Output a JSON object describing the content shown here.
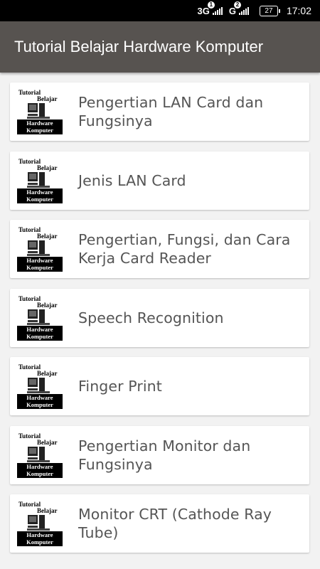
{
  "status_bar": {
    "net1": "3G",
    "sim1": "1",
    "net2": "G",
    "sim2": "2",
    "battery": "27",
    "time": "17:02"
  },
  "app_bar": {
    "title": "Tutorial Belajar Hardware Komputer"
  },
  "thumbnail": {
    "line1": "Tutorial",
    "line2": "Belajar",
    "line3": "Hardware",
    "line4": "Komputer"
  },
  "items": [
    {
      "label": "Pengertian LAN Card dan Fungsinya"
    },
    {
      "label": "Jenis LAN Card"
    },
    {
      "label": "Pengertian, Fungsi, dan Cara Kerja Card Reader"
    },
    {
      "label": "Speech Recognition"
    },
    {
      "label": "Finger Print"
    },
    {
      "label": "Pengertian Monitor dan Fungsinya"
    },
    {
      "label": "Monitor CRT (Cathode Ray Tube)"
    }
  ]
}
